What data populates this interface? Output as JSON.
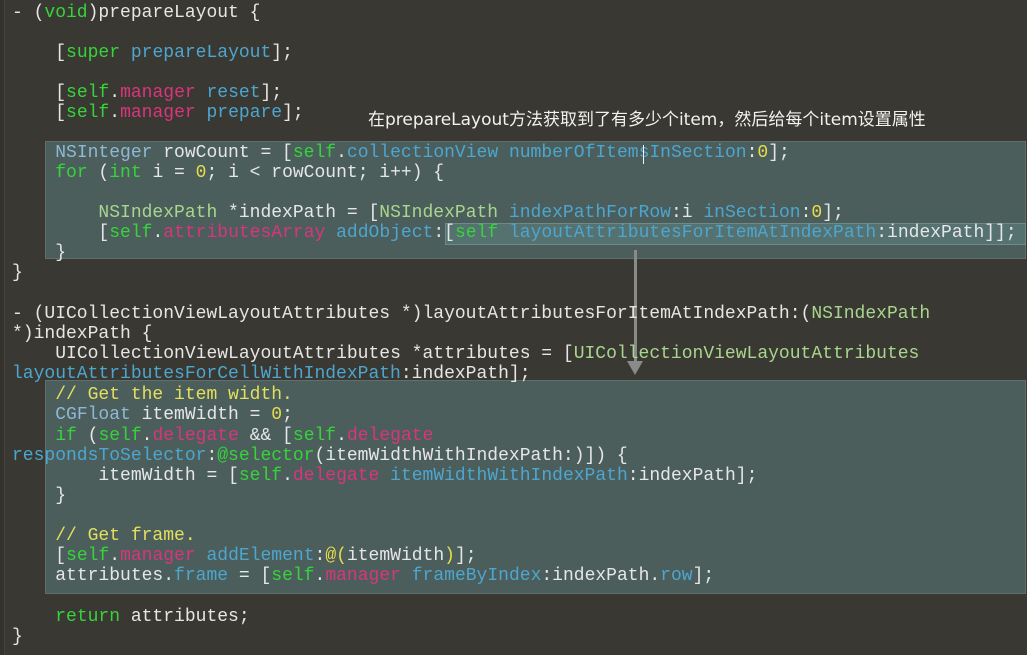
{
  "annotation": "在prepareLayout方法获取到了有多少个item，然后给每个item设置属性",
  "colors": {
    "background": "#3a3832",
    "highlight": "#4b5e5c",
    "keyword": "#36d43a",
    "property": "#d9357c",
    "method": "#4da6cf"
  },
  "code_lines": [
    [
      [
        "- (",
        "t"
      ],
      [
        "void",
        "k"
      ],
      [
        ")prepareLayout {",
        "t"
      ]
    ],
    [
      [
        "    [",
        "t"
      ],
      [
        "super",
        "k"
      ],
      [
        " ",
        "t"
      ],
      [
        "prepareLayout",
        "m"
      ],
      [
        "];",
        "t"
      ]
    ],
    [
      [
        "    [",
        "t"
      ],
      [
        "self",
        "k"
      ],
      [
        ".",
        "t"
      ],
      [
        "manager",
        "p"
      ],
      [
        " ",
        "t"
      ],
      [
        "reset",
        "m"
      ],
      [
        "];",
        "t"
      ]
    ],
    [
      [
        "    [",
        "t"
      ],
      [
        "self",
        "k"
      ],
      [
        ".",
        "t"
      ],
      [
        "manager",
        "p"
      ],
      [
        " ",
        "t"
      ],
      [
        "prepare",
        "m"
      ],
      [
        "];",
        "t"
      ]
    ],
    [
      [
        "    ",
        "t"
      ],
      [
        "NSInteger",
        "c"
      ],
      [
        " rowCount = [",
        "t"
      ],
      [
        "self",
        "k"
      ],
      [
        ".",
        "t"
      ],
      [
        "collectionView",
        "m"
      ],
      [
        " ",
        "t"
      ],
      [
        "numberOfItemsInSection",
        "m"
      ],
      [
        ":",
        "t"
      ],
      [
        "0",
        "n"
      ],
      [
        "];",
        "t"
      ]
    ],
    [
      [
        "    ",
        "t"
      ],
      [
        "for",
        "k"
      ],
      [
        " (",
        "t"
      ],
      [
        "int",
        "k"
      ],
      [
        " i = ",
        "t"
      ],
      [
        "0",
        "n"
      ],
      [
        "; i < rowCount; i++) {",
        "t"
      ]
    ],
    [
      [
        "        ",
        "t"
      ],
      [
        "NSIndexPath",
        "g"
      ],
      [
        " *indexPath = [",
        "t"
      ],
      [
        "NSIndexPath",
        "g"
      ],
      [
        " ",
        "t"
      ],
      [
        "indexPathForRow",
        "m"
      ],
      [
        ":i ",
        "t"
      ],
      [
        "inSection",
        "m"
      ],
      [
        ":",
        "t"
      ],
      [
        "0",
        "n"
      ],
      [
        "];",
        "t"
      ]
    ],
    [
      [
        "        [",
        "t"
      ],
      [
        "self",
        "k"
      ],
      [
        ".",
        "t"
      ],
      [
        "attributesArray",
        "p"
      ],
      [
        " ",
        "t"
      ],
      [
        "addObject",
        "m"
      ],
      [
        ":[",
        "t"
      ],
      [
        "self",
        "k"
      ],
      [
        " ",
        "t"
      ],
      [
        "layoutAttributesForItemAtIndexPath",
        "m"
      ],
      [
        ":indexPath]];",
        "t"
      ]
    ],
    [
      [
        "    }",
        "t"
      ]
    ],
    [
      [
        "}",
        "t"
      ]
    ],
    [
      [
        "- (",
        "t"
      ],
      [
        "UICollectionViewLayoutAttributes",
        "t"
      ],
      [
        " *)layoutAttributesForItemAtIndexPath:(",
        "t"
      ],
      [
        "NSIndexPath",
        "g"
      ],
      [
        " *)indexPath {",
        "t"
      ]
    ],
    [
      [
        "    ",
        "t"
      ],
      [
        "UICollectionViewLayoutAttributes",
        "t"
      ],
      [
        " *attributes = [",
        "t"
      ],
      [
        "UICollectionViewLayoutAttributes",
        "g"
      ],
      [
        " ",
        "t"
      ],
      [
        "layoutAttributesForCellWithIndexPath",
        "m"
      ],
      [
        ":indexPath];",
        "t"
      ]
    ],
    [
      [
        "    ",
        "t"
      ],
      [
        "// Get the item width.",
        "cm"
      ]
    ],
    [
      [
        "    ",
        "t"
      ],
      [
        "CGFloat",
        "c"
      ],
      [
        " itemWidth = ",
        "t"
      ],
      [
        "0",
        "n"
      ],
      [
        ";",
        "t"
      ]
    ],
    [
      [
        "    ",
        "t"
      ],
      [
        "if",
        "k"
      ],
      [
        " (",
        "t"
      ],
      [
        "self",
        "k"
      ],
      [
        ".",
        "t"
      ],
      [
        "delegate",
        "p"
      ],
      [
        " && [",
        "t"
      ],
      [
        "self",
        "k"
      ],
      [
        ".",
        "t"
      ],
      [
        "delegate",
        "p"
      ],
      [
        " ",
        "t"
      ],
      [
        "respondsToSelector",
        "m"
      ],
      [
        ":",
        "t"
      ],
      [
        "@selector",
        "k"
      ],
      [
        "(itemWidthWithIndexPath:)]) {",
        "t"
      ]
    ],
    [
      [
        "        itemWidth = [",
        "t"
      ],
      [
        "self",
        "k"
      ],
      [
        ".",
        "t"
      ],
      [
        "delegate",
        "p"
      ],
      [
        " ",
        "t"
      ],
      [
        "itemWidthWithIndexPath",
        "m"
      ],
      [
        ":indexPath];",
        "t"
      ]
    ],
    [
      [
        "    }",
        "t"
      ]
    ],
    [
      [
        "    ",
        "t"
      ],
      [
        "// Get frame.",
        "cm"
      ]
    ],
    [
      [
        "    [",
        "t"
      ],
      [
        "self",
        "k"
      ],
      [
        ".",
        "t"
      ],
      [
        "manager",
        "p"
      ],
      [
        " ",
        "t"
      ],
      [
        "addElement",
        "m"
      ],
      [
        ":",
        "t"
      ],
      [
        "@(",
        "n"
      ],
      [
        "itemWidth",
        "t"
      ],
      [
        ")",
        "n"
      ],
      [
        "];",
        "t"
      ]
    ],
    [
      [
        "    attributes.",
        "t"
      ],
      [
        "frame",
        "m"
      ],
      [
        " = [",
        "t"
      ],
      [
        "self",
        "k"
      ],
      [
        ".",
        "t"
      ],
      [
        "manager",
        "p"
      ],
      [
        " ",
        "t"
      ],
      [
        "frameByIndex",
        "m"
      ],
      [
        ":indexPath.",
        "t"
      ],
      [
        "row",
        "m"
      ],
      [
        "];",
        "t"
      ]
    ],
    [
      [
        "    ",
        "t"
      ],
      [
        "return",
        "k"
      ],
      [
        " attributes;",
        "t"
      ]
    ],
    [
      [
        "}",
        "t"
      ]
    ]
  ]
}
